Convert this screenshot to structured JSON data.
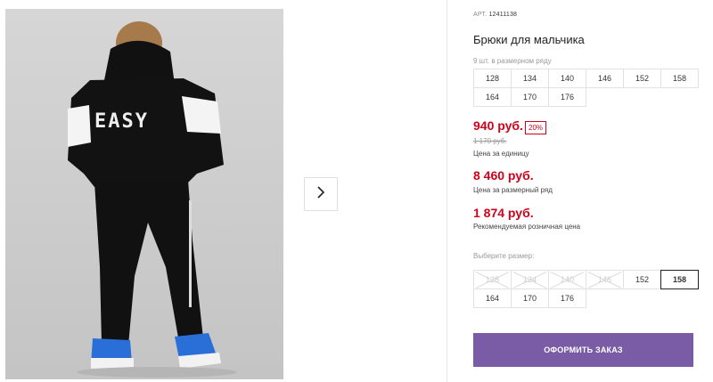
{
  "product": {
    "art_label": "АРТ.",
    "art_number": "12411138",
    "title": "Брюки для мальчика",
    "size_note": "9 шт. в размерном ряду",
    "size_range": [
      "128",
      "134",
      "140",
      "146",
      "152",
      "158",
      "164",
      "170",
      "176"
    ]
  },
  "pricing": {
    "price": "940 руб.",
    "discount": "20%",
    "old_price": "1 170 руб.",
    "unit_label": "Цена за единицу",
    "row_price": "8 460 руб.",
    "row_label": "Цена за размерный ряд",
    "rrp_price": "1 874 руб.",
    "rrp_label": "Рекомендуемая розничная цена"
  },
  "size_select": {
    "prompt": "Выберите размер:",
    "options": [
      {
        "label": "128",
        "available": false,
        "selected": false
      },
      {
        "label": "134",
        "available": false,
        "selected": false
      },
      {
        "label": "140",
        "available": false,
        "selected": false
      },
      {
        "label": "146",
        "available": false,
        "selected": false
      },
      {
        "label": "152",
        "available": true,
        "selected": false
      },
      {
        "label": "158",
        "available": true,
        "selected": true
      },
      {
        "label": "164",
        "available": true,
        "selected": false
      },
      {
        "label": "170",
        "available": true,
        "selected": false
      },
      {
        "label": "176",
        "available": true,
        "selected": false
      }
    ]
  },
  "gallery": {
    "next_icon": "chevron-right-icon",
    "photo_print": "EASY"
  },
  "actions": {
    "order_label": "ОФОРМИТЬ ЗАКАЗ"
  },
  "colors": {
    "price_red": "#d0021b",
    "button_purple": "#7a5ca6"
  }
}
